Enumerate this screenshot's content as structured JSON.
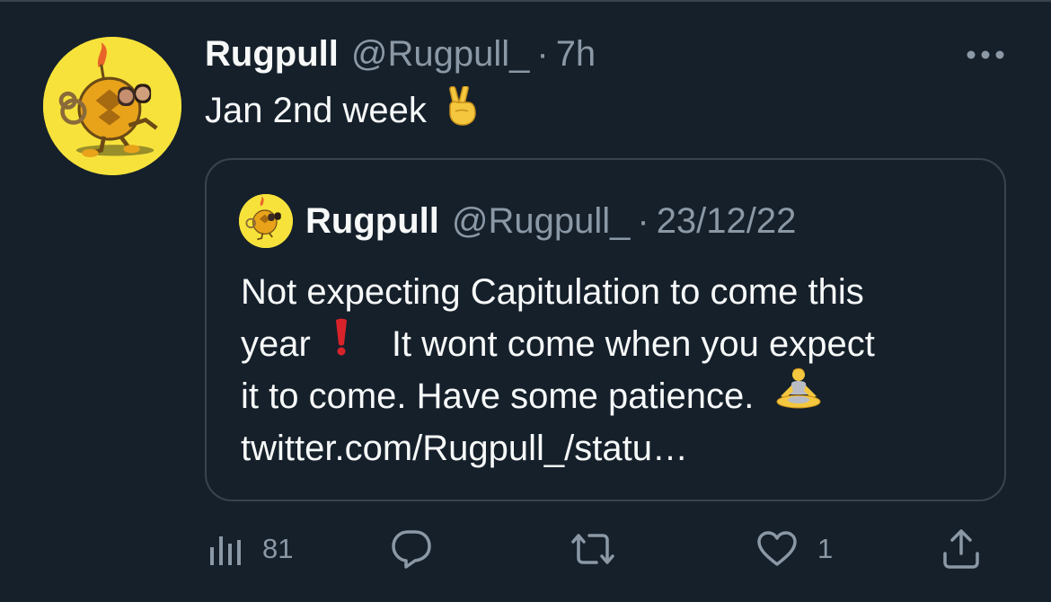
{
  "tweet": {
    "display_name": "Rugpull",
    "handle": "@Rugpull_",
    "separator": "·",
    "time": "7h",
    "text": "Jan 2nd week",
    "emoji": "✌️",
    "more_icon": "more-horizontal-icon"
  },
  "quoted_tweet": {
    "display_name": "Rugpull",
    "handle": "@Rugpull_",
    "separator": "·",
    "date": "23/12/22",
    "lines": [
      "Not expecting Capitulation to come this",
      "year",
      "It wont come when you expect",
      "it to come. Have some patience.",
      "twitter.com/Rugpull_/statu…"
    ],
    "exclamation_emoji": "❗",
    "meditation_emoji": "🧘"
  },
  "actions": {
    "views_count": "81",
    "likes_count": "1",
    "icons": [
      "views-icon",
      "reply-icon",
      "retweet-icon",
      "like-icon",
      "share-icon"
    ]
  },
  "colors": {
    "background": "#15202b",
    "text": "#f7f9f9",
    "secondary": "#8b98a5",
    "border": "#38444d",
    "avatar_yellow": "#f7e23b"
  }
}
